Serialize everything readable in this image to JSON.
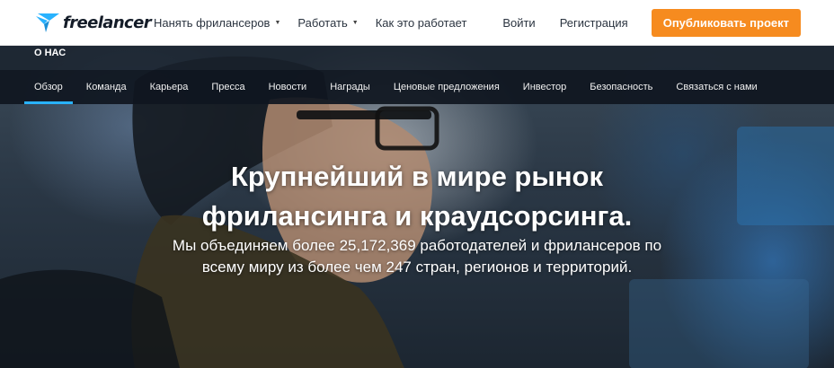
{
  "header": {
    "logo_text": "freelancer",
    "nav": [
      {
        "label": "Нанять фрилансеров",
        "has_dropdown": true
      },
      {
        "label": "Работать",
        "has_dropdown": true
      },
      {
        "label": "Как это работает",
        "has_dropdown": false
      }
    ],
    "login_label": "Войти",
    "signup_label": "Регистрация",
    "post_project_label": "Опубликовать проект",
    "accent_color": "#f68b1f",
    "logo_color": "#29b2fe"
  },
  "section": {
    "title": "О НАС"
  },
  "subnav": {
    "items": [
      {
        "label": "Обзор",
        "active": true
      },
      {
        "label": "Команда"
      },
      {
        "label": "Карьера"
      },
      {
        "label": "Пресса"
      },
      {
        "label": "Новости"
      },
      {
        "label": "Награды"
      },
      {
        "label": "Ценовые предложения"
      },
      {
        "label": "Инвестор"
      },
      {
        "label": "Безопасность"
      },
      {
        "label": "Связаться с нами"
      }
    ],
    "active_color": "#29b2fe"
  },
  "hero": {
    "headline_line1": "Крупнейший в мире рынок",
    "headline_line2": "фрилансинга и краудсорсинга.",
    "subline_line1": "Мы объединяем более 25,172,369 работодателей и фрилансеров по",
    "subline_line2": "всему миру из более чем 247 стран, регионов и территорий."
  }
}
